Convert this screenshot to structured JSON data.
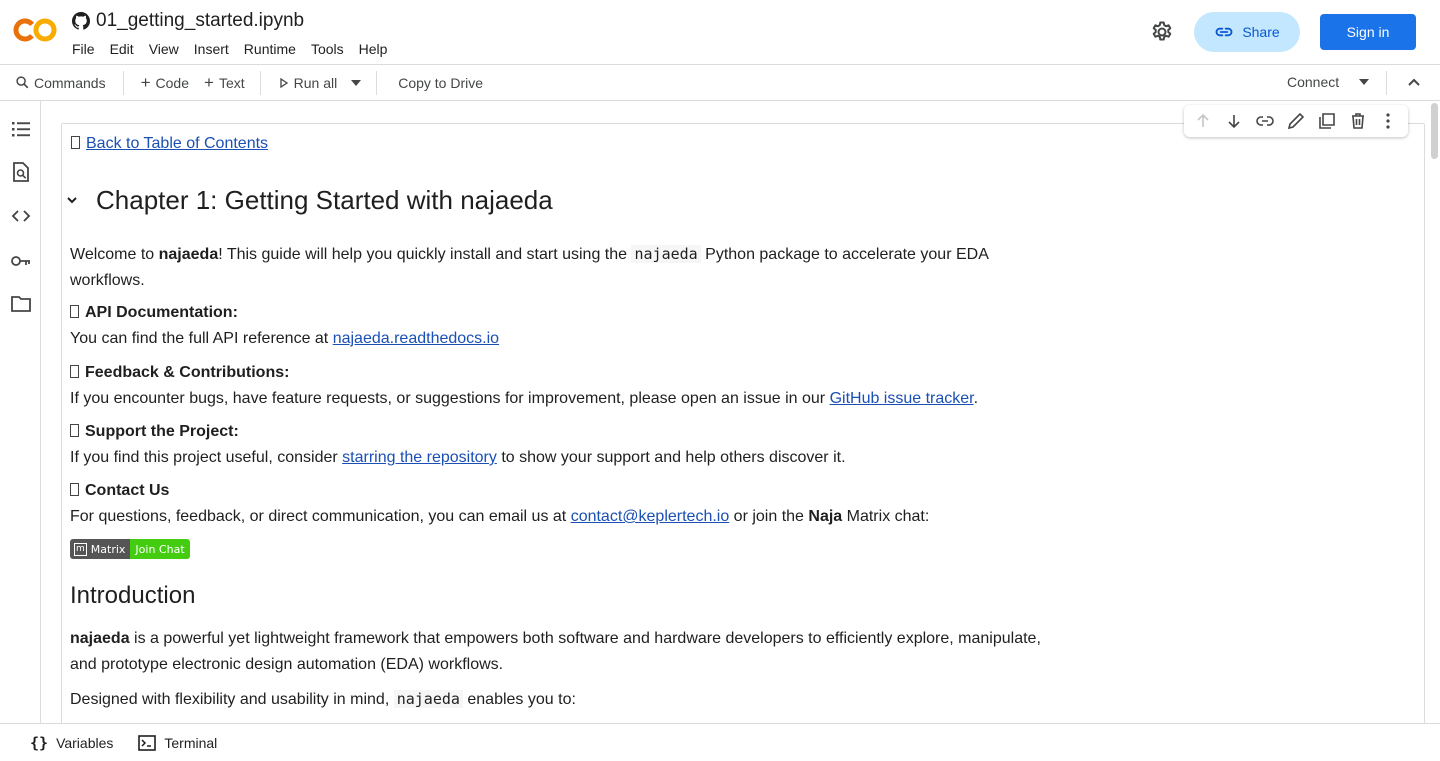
{
  "header": {
    "file_name": "01_getting_started.ipynb",
    "menu": [
      "File",
      "Edit",
      "View",
      "Insert",
      "Runtime",
      "Tools",
      "Help"
    ],
    "share_label": "Share",
    "signin_label": "Sign in"
  },
  "toolbar": {
    "commands": "Commands",
    "code": "Code",
    "text": "Text",
    "run_all": "Run all",
    "copy_to_drive": "Copy to Drive",
    "connect": "Connect"
  },
  "bottombar": {
    "variables": "Variables",
    "terminal": "Terminal"
  },
  "notebook": {
    "back_link": "Back to Table of Contents",
    "chapter_title": "Chapter 1: Getting Started with najaeda",
    "welcome": {
      "p1": "Welcome to ",
      "b1": "najaeda",
      "p2": "! This guide will help you quickly install and start using the ",
      "code": "najaeda",
      "p3": " Python package to accelerate your EDA",
      "line2": "workflows."
    },
    "api_doc": {
      "heading": "API Documentation:",
      "text": "You can find the full API reference at ",
      "link": "najaeda.readthedocs.io"
    },
    "feedback": {
      "heading": "Feedback & Contributions:",
      "text": "If you encounter bugs, have feature requests, or suggestions for improvement, please open an issue in our ",
      "link": "GitHub issue tracker",
      "end": "."
    },
    "support": {
      "heading": "Support the Project:",
      "text": "If you find this project useful, consider ",
      "link": "starring the repository",
      "end": " to show your support and help others discover it."
    },
    "contact": {
      "heading": "Contact Us",
      "text": "For questions, feedback, or direct communication, you can email us at ",
      "link": "contact@keplertech.io",
      "mid": " or join the ",
      "bold": "Naja",
      "end": " Matrix chat:"
    },
    "badge": {
      "icon": "m",
      "left": "Matrix",
      "right": "Join Chat"
    },
    "intro_title": "Introduction",
    "intro": {
      "bold": "najaeda",
      "text": " is a powerful yet lightweight framework that empowers both software and hardware developers to efficiently explore, manipulate,",
      "line2": "and prototype electronic design automation (EDA) workflows."
    },
    "designed": {
      "text": "Designed with flexibility and usability in mind, ",
      "code": "najaeda",
      "end": " enables you to:"
    }
  },
  "colors": {
    "accent_blue": "#1a73e8",
    "share_bg": "#c2e7ff",
    "link": "#1a4fb4",
    "logo_orange": "#f9ab00",
    "logo_dark_orange": "#e8710a",
    "badge_green": "#4c1"
  }
}
